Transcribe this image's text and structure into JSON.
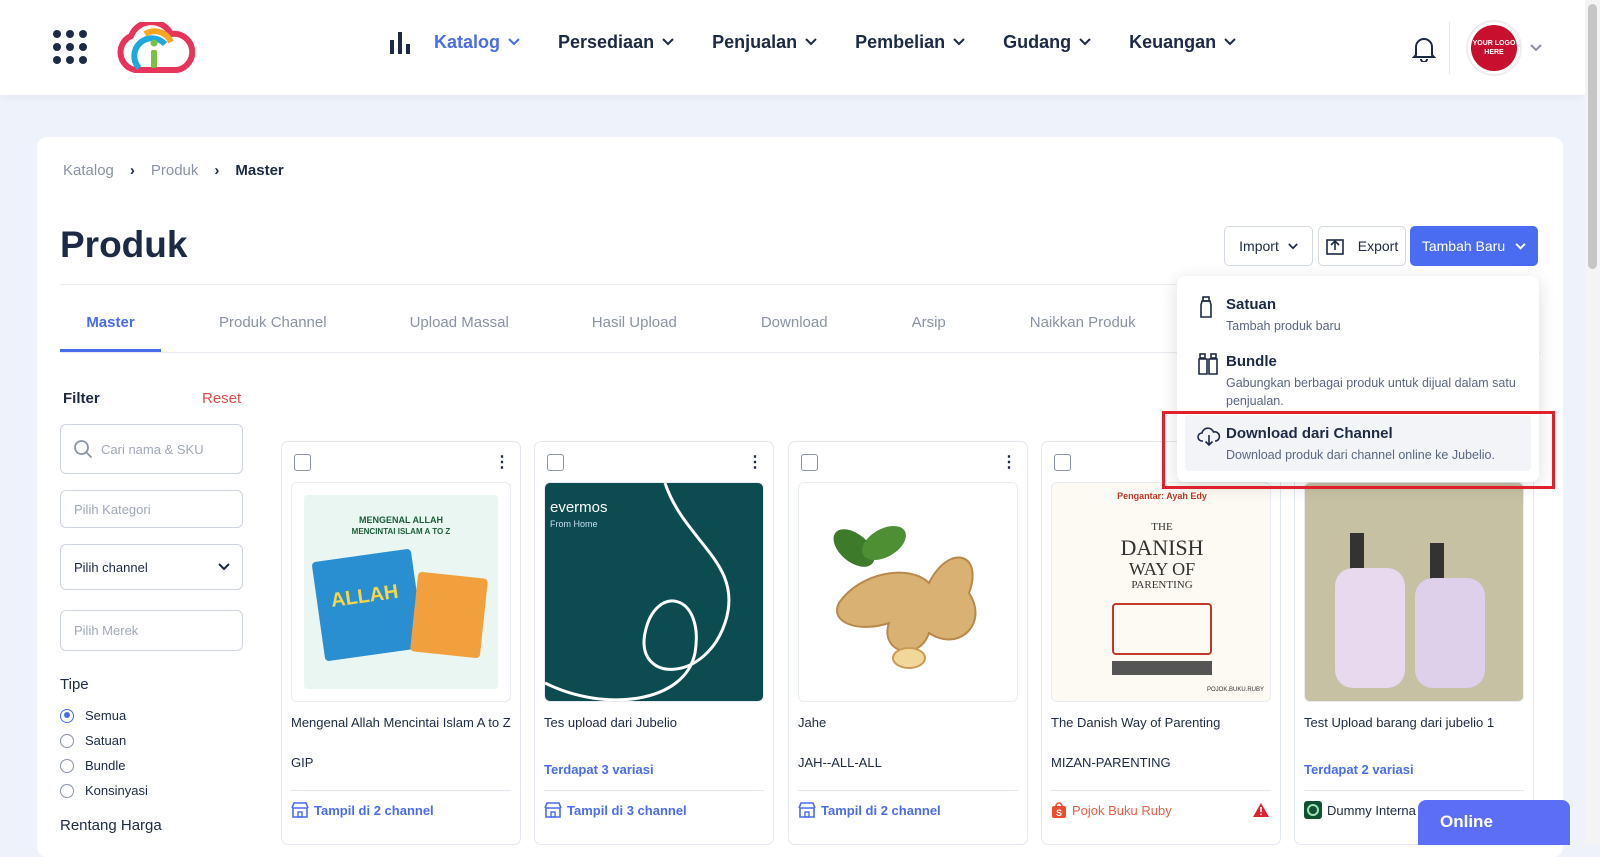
{
  "nav": {
    "items": [
      {
        "label": "Katalog",
        "active": true
      },
      {
        "label": "Persediaan",
        "active": false
      },
      {
        "label": "Penjualan",
        "active": false
      },
      {
        "label": "Pembelian",
        "active": false
      },
      {
        "label": "Gudang",
        "active": false
      },
      {
        "label": "Keuangan",
        "active": false
      }
    ],
    "avatar_text": "YOUR LOGO HERE"
  },
  "breadcrumb": [
    "Katalog",
    "Produk",
    "Master"
  ],
  "page": {
    "title": "Produk"
  },
  "actions": {
    "import": "Import",
    "export": "Export",
    "add": "Tambah Baru"
  },
  "tabs": [
    "Master",
    "Produk Channel",
    "Upload Massal",
    "Hasil Upload",
    "Download",
    "Arsip",
    "Naikkan Produk"
  ],
  "filter": {
    "title": "Filter",
    "reset": "Reset",
    "search_placeholder": "Cari nama & SKU",
    "kategori_placeholder": "Pilih Kategori",
    "channel_placeholder": "Pilih channel",
    "merek_placeholder": "Pilih Merek",
    "tipe_title": "Tipe",
    "tipe_options": [
      "Semua",
      "Satuan",
      "Bundle",
      "Konsinyasi"
    ],
    "tipe_selected": "Semua",
    "rentang_title": "Rentang Harga"
  },
  "products": [
    {
      "name": "Mengenal Allah Mencintai Islam A to Z",
      "sku": "GIP",
      "channel": "Tampil di 2 channel"
    },
    {
      "name": "Tes upload dari Jubelio",
      "variasi": "Terdapat 3 variasi",
      "channel": "Tampil di 3 channel",
      "img_text": [
        "evermos",
        "From Home"
      ]
    },
    {
      "name": "Jahe",
      "sku": "JAH--ALL-ALL",
      "channel": "Tampil di 2 channel"
    },
    {
      "name": "The Danish Way of Parenting",
      "sku": "MIZAN-PARENTING",
      "channel": "Pojok Buku Ruby",
      "img_text": [
        "Pengantar: Ayah Edy",
        "THE",
        "DANISH",
        "WAY OF",
        "PARENTING",
        "POJOK.BUKU.RUBY"
      ]
    },
    {
      "name": "Test Upload barang dari jubelio 1",
      "variasi": "Terdapat 2 variasi",
      "channel": "Dummy Interna"
    }
  ],
  "book1_text": [
    "MENGENAL ALLAH",
    "MENCINTAI ISLAM A TO Z",
    "ALLAH"
  ],
  "dropdown": [
    {
      "title": "Satuan",
      "desc": "Tambah produk baru",
      "icon": "bottle-icon"
    },
    {
      "title": "Bundle",
      "desc": "Gabungkan berbagai produk untuk dijual dalam satu penjualan.",
      "icon": "bundle-icon"
    },
    {
      "title": "Download dari Channel",
      "desc": "Download produk dari channel online ke Jubelio.",
      "icon": "cloud-download-icon"
    }
  ],
  "chat": {
    "label": "Online"
  },
  "colors": {
    "accent": "#4a6cf0",
    "danger": "#e0202a",
    "text": "#1c2a45"
  }
}
